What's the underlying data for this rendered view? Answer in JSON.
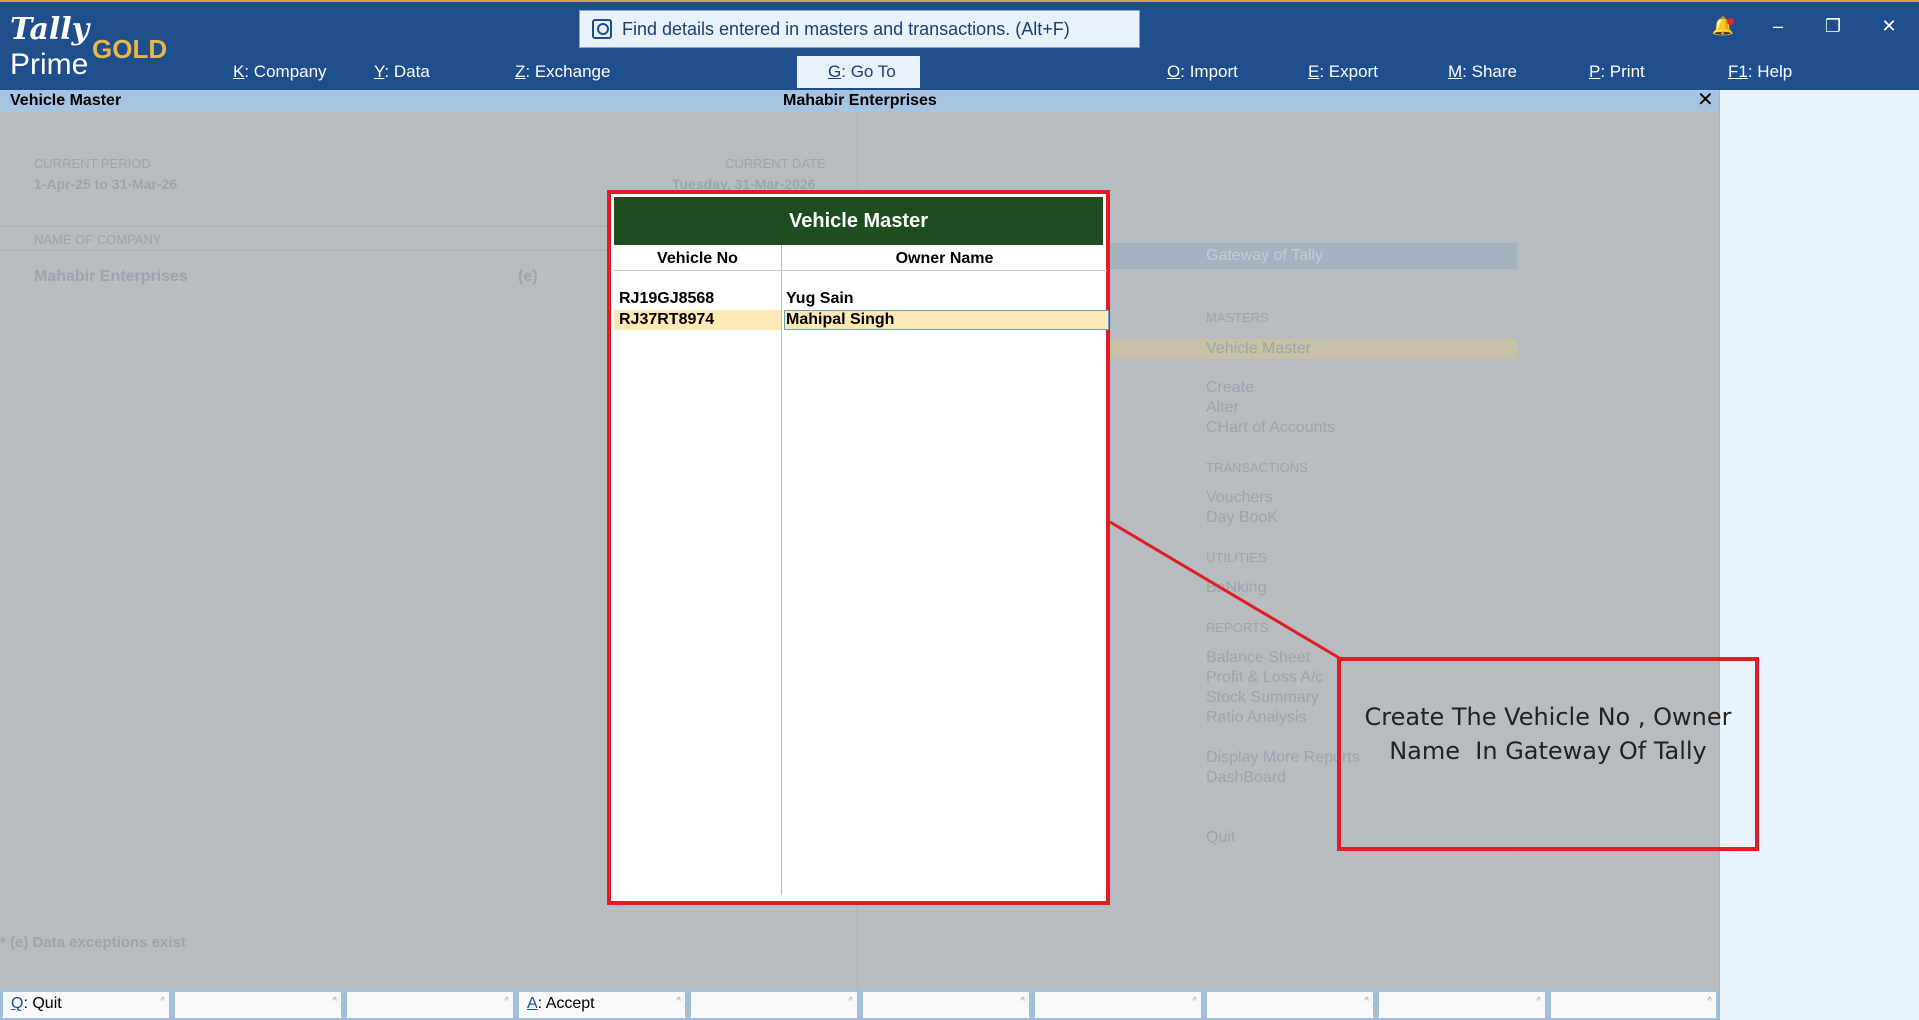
{
  "app": {
    "logo_tally": "Tally",
    "logo_prime": "Prime",
    "edition": "GOLD"
  },
  "search": {
    "text": "Find details entered in masters and transactions. (Alt+F)"
  },
  "top_menu": [
    {
      "key": "K",
      "label": "Company"
    },
    {
      "key": "Y",
      "label": "Data"
    },
    {
      "key": "Z",
      "label": "Exchange"
    },
    {
      "key": "G",
      "label": "Go To"
    },
    {
      "key": "O",
      "label": "Import"
    },
    {
      "key": "E",
      "label": "Export"
    },
    {
      "key": "M",
      "label": "Share"
    },
    {
      "key": "P",
      "label": "Print"
    },
    {
      "key": "F1",
      "label": "Help"
    }
  ],
  "window": {
    "minimize": "–",
    "restore": "❐",
    "close": "✕",
    "bell": "🔔"
  },
  "title_bar": {
    "screen": "Vehicle Master",
    "company": "Mahabir Enterprises",
    "close": "✕"
  },
  "background": {
    "current_period_label": "CURRENT PERIOD",
    "current_period": "1-Apr-25 to 31-Mar-26",
    "current_date_label": "CURRENT DATE",
    "current_date": "Tuesday, 31-Mar-2026",
    "name_of_company_label": "NAME OF COMPANY",
    "company_name": "Mahabir Enterprises",
    "company_flag": "(e)",
    "exceptions_note": "* (e) Data exceptions exist",
    "gateway": {
      "title": "Gateway of Tally",
      "masters_label": "MASTERS",
      "highlighted": "Vehicle Master",
      "masters": [
        "Create",
        "Alter",
        "CHart of Accounts"
      ],
      "transactions_label": "TRANSACTIONS",
      "transactions": [
        "Vouchers",
        "Day BooK"
      ],
      "utilities_label": "UTILITIES",
      "utilities": [
        "BaNking"
      ],
      "reports_label": "REPORTS",
      "reports": [
        "Balance Sheet",
        "Profit & Loss A/c",
        "Stock Summary",
        "Ratio Analysis"
      ],
      "more": [
        "Display More Reports",
        "DashBoard"
      ],
      "quit": "Quit"
    }
  },
  "popup": {
    "title": "Vehicle Master",
    "columns": [
      "Vehicle No",
      "Owner Name"
    ],
    "rows": [
      {
        "vehicle_no": "RJ19GJ8568",
        "owner_name": "Yug Sain"
      },
      {
        "vehicle_no": "RJ37RT8974",
        "owner_name": "Mahipal Singh"
      }
    ]
  },
  "annotation": {
    "line1": "Create The Vehicle No , Owner",
    "line2": "Name  In Gateway Of Tally"
  },
  "footer": [
    {
      "key": "Q",
      "label": "Quit"
    },
    {
      "key": "",
      "label": ""
    },
    {
      "key": "",
      "label": ""
    },
    {
      "key": "A",
      "label": "Accept"
    }
  ],
  "colors": {
    "topbar": "#1e4e8c",
    "popup_header": "#1e4d21",
    "highlight": "#e11c24"
  }
}
